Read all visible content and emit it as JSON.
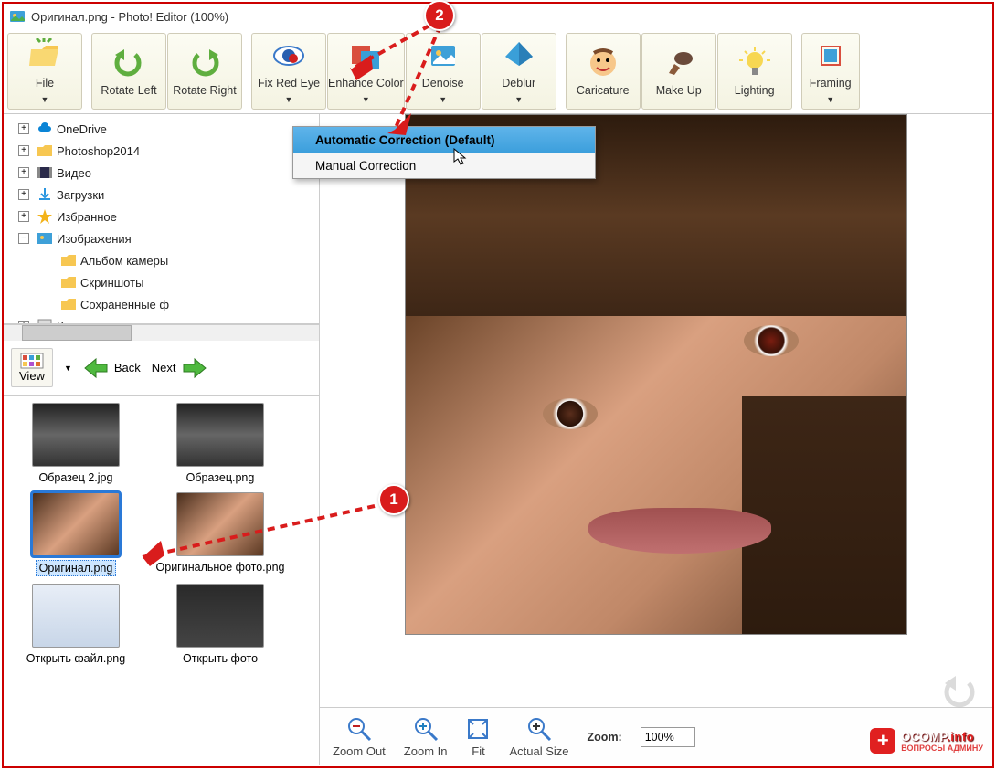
{
  "window": {
    "title": "Оригинал.png - Photo! Editor (100%)"
  },
  "toolbar": {
    "file": "File",
    "rotate_left": "Rotate Left",
    "rotate_right": "Rotate Right",
    "fix_red_eye": "Fix Red Eye",
    "enhance_color": "Enhance Color",
    "denoise": "Denoise",
    "deblur": "Deblur",
    "caricature": "Caricature",
    "make_up": "Make Up",
    "lighting": "Lighting",
    "framing": "Framing"
  },
  "dropdown": {
    "auto": "Automatic Correction (Default)",
    "manual": "Manual Correction"
  },
  "tree": {
    "items": [
      {
        "label": "OneDrive",
        "icon": "cloud",
        "color": "#0a84d6",
        "expand": "+"
      },
      {
        "label": "Photoshop2014",
        "icon": "folder",
        "color": "#f7c752",
        "expand": "+"
      },
      {
        "label": "Видео",
        "icon": "video",
        "color": "#3971c9",
        "expand": "+"
      },
      {
        "label": "Загрузки",
        "icon": "download",
        "color": "#2a96e0",
        "expand": "+"
      },
      {
        "label": "Избранное",
        "icon": "star",
        "color": "#f3b31a",
        "expand": "+"
      },
      {
        "label": "Изображения",
        "icon": "pictures",
        "color": "#3ea0d8",
        "expand": "−"
      },
      {
        "label": "Альбом камеры",
        "icon": "folder",
        "color": "#f7c752",
        "indent": 1
      },
      {
        "label": "Скриншоты",
        "icon": "folder",
        "color": "#f7c752",
        "indent": 1
      },
      {
        "label": "Сохраненные ф",
        "icon": "folder",
        "color": "#f7c752",
        "indent": 1
      },
      {
        "label": "Контакты",
        "icon": "contacts",
        "color": "#888",
        "expand": "+"
      }
    ]
  },
  "nav": {
    "view": "View",
    "back": "Back",
    "next": "Next"
  },
  "thumbs": {
    "items": [
      {
        "label": "Образец 2.jpg",
        "kind": "bw"
      },
      {
        "label": "Образец.png",
        "kind": "bw"
      },
      {
        "label": "Оригинал.png",
        "kind": "face",
        "selected": true
      },
      {
        "label": "Оригинальное фото.png",
        "kind": "face"
      },
      {
        "label": "Открыть файл.png",
        "kind": "screenshot"
      },
      {
        "label": "Открыть фото",
        "kind": "screenshot-dark"
      }
    ]
  },
  "zoom": {
    "out": "Zoom Out",
    "in": "Zoom In",
    "fit": "Fit",
    "actual": "Actual Size",
    "label": "Zoom:",
    "value": "100%"
  },
  "callouts": {
    "b1": "1",
    "b2": "2"
  },
  "watermark": {
    "brand": "OCOMP",
    "suffix": ".info",
    "sub": "ВОПРОСЫ АДМИНУ"
  }
}
